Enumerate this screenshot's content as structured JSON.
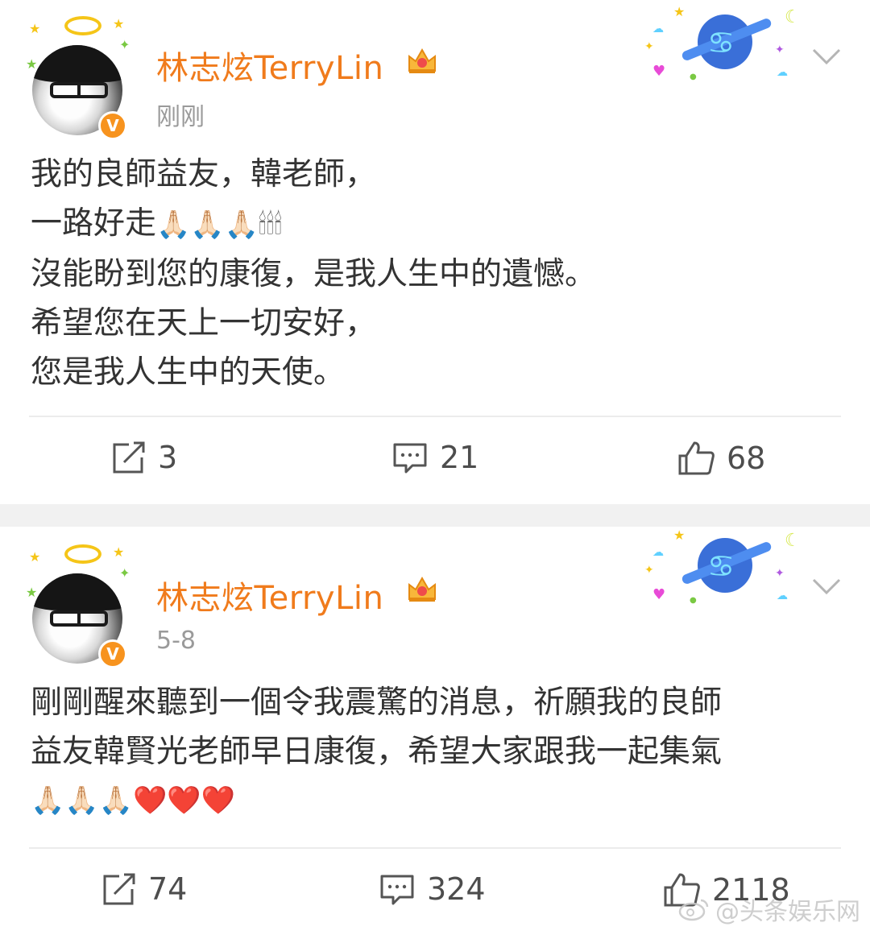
{
  "posts": [
    {
      "username": "林志炫TerryLin",
      "time": "刚刚",
      "text_lines": [
        "我的良師益友，韓老師，",
        "一路好走",
        "沒能盼到您的康復，是我人生中的遺憾。",
        "希望您在天上一切安好，",
        "您是我人生中的天使。"
      ],
      "emoji_line2": "🙏🏻🙏🏻🙏🏻🕯🕯🕯",
      "reposts": "3",
      "comments": "21",
      "likes": "68"
    },
    {
      "username": "林志炫TerryLin",
      "time": "5-8",
      "text_lines": [
        "剛剛醒來聽到一個令我震驚的消息，祈願我的良師",
        "益友韓賢光老師早日康復，希望大家跟我一起集氣"
      ],
      "emoji_line3": "🙏🏻🙏🏻🙏🏻❤️❤️❤️",
      "reposts": "74",
      "comments": "324",
      "likes": "2118"
    }
  ],
  "watermark": "@头条娱乐网",
  "icons": {
    "repost": "repost-icon",
    "comment": "comment-icon",
    "like": "thumbs-up-icon",
    "verified": "verified-v-badge",
    "menu": "chevron-down-icon",
    "crown": "crown-icon",
    "sticker": "cancer-zodiac-sticker"
  },
  "colors": {
    "username": "#f07b1c",
    "time": "#9a9a9a",
    "text": "#333333",
    "verified": "#f7931e",
    "separator": "#f1f1f1"
  }
}
